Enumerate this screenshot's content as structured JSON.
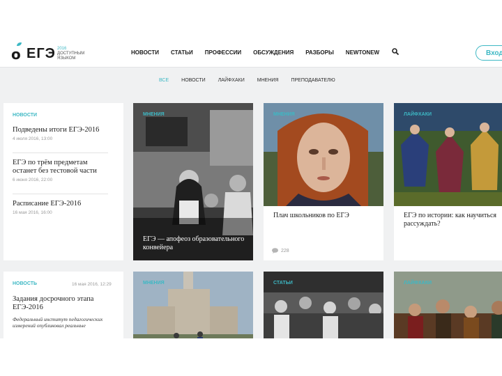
{
  "logo": {
    "mark": "ЕГЭ",
    "year": "2016",
    "line1": "доступным",
    "line2": "языком"
  },
  "nav": [
    "Новости",
    "Статьи",
    "Профессии",
    "Обсуждения",
    "Разборы",
    "NEWTONEW"
  ],
  "login": "Вход",
  "subnav": [
    "Все",
    "Новости",
    "Лайфхаки",
    "Мнения",
    "Преподавателю"
  ],
  "news_card": {
    "tag": "Новости",
    "items": [
      {
        "title": "Подведены итоги ЕГЭ-2016",
        "date": "4 июля 2016, 13:00"
      },
      {
        "title": "ЕГЭ по трём предметам останет без тестовой части",
        "date": "6 июня 2016, 22:00"
      },
      {
        "title": "Расписание ЕГЭ-2016",
        "date": "16 мая 2016, 16:00"
      }
    ]
  },
  "cards_row1": [
    {
      "tag": "Мнения",
      "caption": "ЕГЭ — апофеоз образовательного конвейера"
    },
    {
      "tag": "Мнения",
      "caption": "Плач школьников по ЕГЭ",
      "comments": "228"
    },
    {
      "tag": "Лайфхаки",
      "caption": "ЕГЭ по истории: как научиться рассуждать?"
    }
  ],
  "news_card2": {
    "tag": "Новость",
    "date": "16 мая 2016, 12:29",
    "title": "Задания досрочного этапа ЕГЭ-2016",
    "text": "Федеральный институт педагогических измерений опубликовал реальные"
  },
  "cards_row2": [
    {
      "tag": "Мнения"
    },
    {
      "tag": "Статьи"
    },
    {
      "tag": "Лайфхаки"
    }
  ],
  "colors": {
    "accent": "#3db8c4",
    "background": "#f0f1f2",
    "text": "#1c1c1c"
  }
}
